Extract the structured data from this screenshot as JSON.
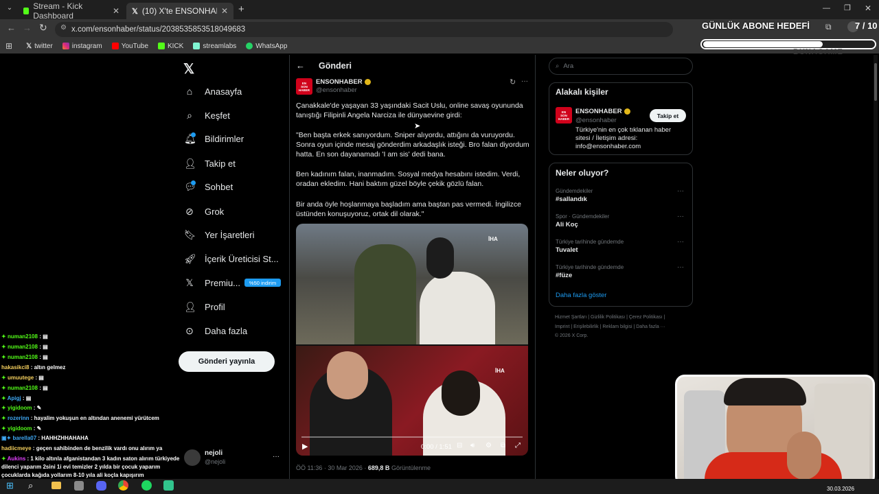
{
  "browser": {
    "tabs": [
      {
        "label": "Stream - Kick Dashboard"
      },
      {
        "label": "(10) X'te ENSONHABER: \"Çanak"
      }
    ],
    "url": "x.com/ensonhaber/status/2038535853518049683",
    "bookmarks": [
      "twitter",
      "instagram",
      "YouTube",
      "KICK",
      "streamlabs",
      "WhatsApp"
    ]
  },
  "overlay": {
    "goal_title": "GÜNLÜK ABONE HEDEFİ",
    "goal_count": "7 / 10",
    "goal_progress": 0.7,
    "watermark": "BUNAGAME"
  },
  "nav": {
    "items": [
      {
        "label": "Anasayfa",
        "icon": "home-icon"
      },
      {
        "label": "Keşfet",
        "icon": "search-icon"
      },
      {
        "label": "Bildirimler",
        "icon": "bell-icon"
      },
      {
        "label": "Takip et",
        "icon": "person-plus-icon"
      },
      {
        "label": "Sohbet",
        "icon": "chat-icon"
      },
      {
        "label": "Grok",
        "icon": "grok-icon"
      },
      {
        "label": "Yer İşaretleri",
        "icon": "bookmark-icon"
      },
      {
        "label": "İçerik Üreticisi St...",
        "icon": "rocket-icon"
      },
      {
        "label": "Premiu...",
        "icon": "x-logo-icon"
      },
      {
        "label": "Profil",
        "icon": "person-icon"
      },
      {
        "label": "Daha fazla",
        "icon": "more-circle-icon"
      }
    ],
    "premium_badge": "%50 indirim",
    "post_button": "Gönderi yayınla",
    "account": {
      "name": "nejoli",
      "handle": "@nejoli"
    }
  },
  "post": {
    "header": "Gönderi",
    "author": "ENSONHABER",
    "handle": "@ensonhaber",
    "paragraphs": [
      "Çanakkale'de yaşayan 33 yaşındaki Sacit Uslu, online savaş oyununda tanıştığı Filipinli Angela Narciza ile dünyaevine girdi:",
      "\"Ben başta erkek sanıyordum. Sniper alıyordu, attığını da vuruyordu. Sonra oyun içinde mesaj gönderdim arkadaşlık isteği. Bro falan diyordum hatta. En son dayanamadı 'I am sis' dedi bana.",
      "Ben kadınım falan, inanmadım. Sosyal medya hesabını istedim. Verdi, oradan ekledim. Hani baktım güzel böyle çekik gözlü falan.",
      "Bir anda öyle hoşlanmaya başladım ama baştan pas vermedi. İngilizce üstünden konuşuyoruz, ortak dil olarak.\""
    ],
    "video_time": "0:00 / 1:51",
    "video_watermark": "İHA",
    "meta_time": "ÖÖ 11:36 · 30 Mar 2026 · ",
    "views": "689,8 B",
    "views_label": "Görüntülenme"
  },
  "search": {
    "placeholder": "Ara"
  },
  "related": {
    "title": "Alakalı kişiler",
    "name": "ENSONHABER",
    "handle": "@ensonhaber",
    "bio": "Türkiye'nin en çok tıklanan haber sitesi / İletişim adresi: info@ensonhaber.com",
    "follow": "Takip et"
  },
  "trends": {
    "title": "Neler oluyor?",
    "items": [
      {
        "category": "Gündemdekiler",
        "name": "#sallandık"
      },
      {
        "category": "Spor · Gündemdekiler",
        "name": "Ali Koç"
      },
      {
        "category": "Türkiye tarihinde gündemde",
        "name": "Tuvalet"
      },
      {
        "category": "Türkiye tarihinde gündemde",
        "name": "#füze"
      }
    ],
    "more": "Daha fazla göster"
  },
  "footer": {
    "line1": "Hizmet Şartları | Gizlilik Politikası | Çerez Politikası |",
    "line2": "Imprint | Erişilebilirlik | Reklam bilgisi | Daha fazla ···",
    "line3": "© 2026 X Corp."
  },
  "chat": [
    {
      "user": "numan2108",
      "msg": ""
    },
    {
      "user": "numan2108",
      "msg": ""
    },
    {
      "user": "numan2108",
      "msg": ""
    },
    {
      "user": "hakasikci8",
      "msg": "altın gelmez"
    },
    {
      "user": "umuutege",
      "msg": ""
    },
    {
      "user": "numan2108",
      "msg": ""
    },
    {
      "user": "Apigj",
      "msg": ""
    },
    {
      "user": "yigidoom",
      "msg": ""
    },
    {
      "user": "rozerinn",
      "msg": "hayalim yokuşun en altından anenemi yürütcem"
    },
    {
      "user": "yigidoom",
      "msg": ""
    },
    {
      "user": "barella07",
      "msg": "HAHHZHHAHAHA"
    },
    {
      "user": "hadiicmeye",
      "msg": "geçen sahibinden de benzilik vardı onu alırım ya"
    },
    {
      "user": "Aukins",
      "msg": "1 kilo altınla afganistandan 3 kadın saton alırım türkiyede dilenci yaparım 2sini 1i evi temizler 2 yılda bir çocuk yaparım çocuklarda kağıda yollarım 8-10 yıla ali koçla kapışırım"
    }
  ],
  "taskbar": {
    "date": "30.03.2026"
  }
}
